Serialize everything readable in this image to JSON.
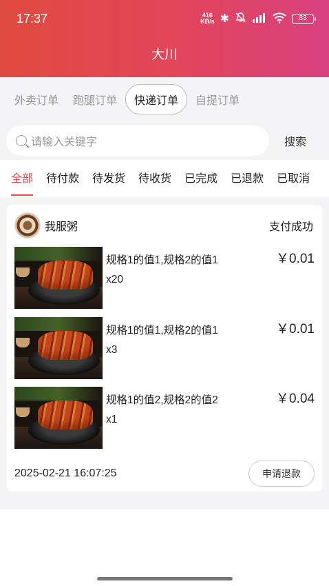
{
  "status_bar": {
    "time": "17:37",
    "net_speed_value": "416",
    "net_speed_unit": "KB/s",
    "battery": "83",
    "icons": [
      "bluetooth-icon",
      "bell-muted-icon",
      "signal-icon",
      "wifi-icon",
      "battery-icon"
    ]
  },
  "nav": {
    "title": "大川"
  },
  "order_types": [
    {
      "label": "外卖订单",
      "active": false
    },
    {
      "label": "跑腿订单",
      "active": false
    },
    {
      "label": "快递订单",
      "active": true
    },
    {
      "label": "自提订单",
      "active": false
    }
  ],
  "search": {
    "placeholder": "请输入关键字",
    "button_label": "搜索"
  },
  "status_tabs": [
    {
      "label": "全部",
      "active": true
    },
    {
      "label": "待付款",
      "active": false
    },
    {
      "label": "待发货",
      "active": false
    },
    {
      "label": "待收货",
      "active": false
    },
    {
      "label": "已完成",
      "active": false
    },
    {
      "label": "已退款",
      "active": false
    },
    {
      "label": "已取消",
      "active": false
    }
  ],
  "order": {
    "shop_name": "我服粥",
    "pay_status": "支付成功",
    "items": [
      {
        "spec": "规格1的值1,规格2的值1",
        "qty": "x20",
        "price": "￥0.01"
      },
      {
        "spec": "规格1的值1,规格2的值1",
        "qty": "x3",
        "price": "￥0.01"
      },
      {
        "spec": "规格1的值2,规格2的值2",
        "qty": "x1",
        "price": "￥0.04"
      }
    ],
    "time": "2025-02-21 16:07:25",
    "refund_label": "申请退款"
  },
  "colors": {
    "header_start": "#e04b3f",
    "header_end": "#d9407f",
    "accent": "#e24a4a"
  }
}
